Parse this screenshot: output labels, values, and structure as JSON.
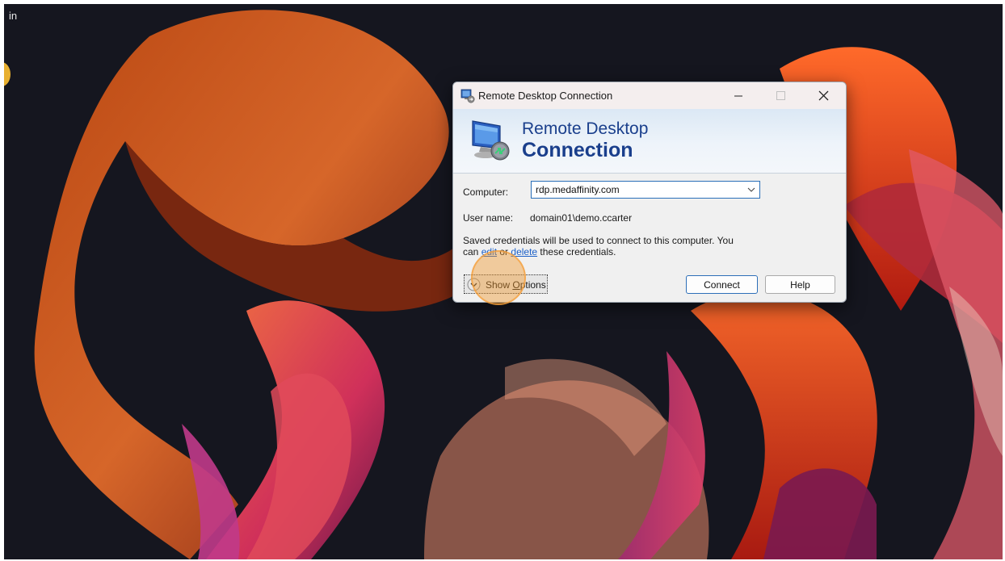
{
  "desktop": {
    "corner_text": "in"
  },
  "dialog": {
    "title": "Remote Desktop Connection",
    "banner_line1": "Remote Desktop",
    "banner_line2": "Connection",
    "computer_label": "Computer:",
    "computer_value": "rdp.medaffinity.com",
    "username_label": "User name:",
    "username_value": "domain01\\demo.ccarter",
    "cred_text_1": "Saved credentials will be used to connect to this computer.  You",
    "cred_text_2a": "can ",
    "edit_link": "edit",
    "cred_text_2b": " or ",
    "delete_link": "delete",
    "cred_text_2c": " these credentials.",
    "show_options_prefix": "Show ",
    "show_options_accel": "O",
    "show_options_suffix": "ptions",
    "connect_label": "Connect",
    "help_label": "Help"
  },
  "colors": {
    "accent": "#1a3f8c",
    "link": "#1a5fc8",
    "focus": "#2a6fb8"
  },
  "icons": [
    "rdc-app-icon",
    "minimize-icon",
    "maximize-icon",
    "close-icon",
    "rdc-banner-icon",
    "chevron-down-icon",
    "expand-options-icon"
  ]
}
